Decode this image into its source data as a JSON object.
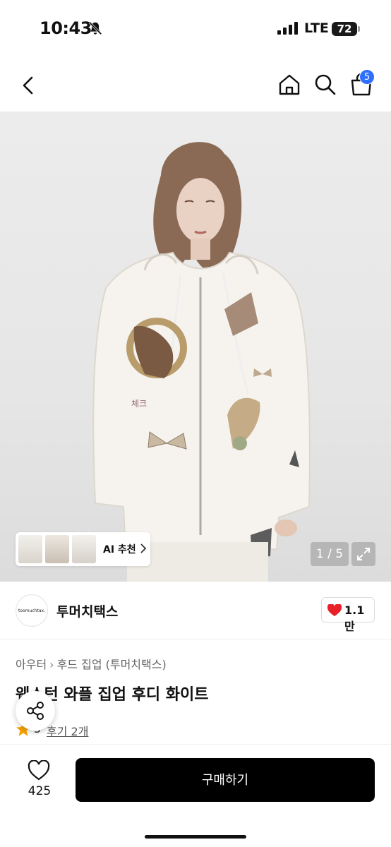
{
  "status_bar": {
    "time": "10:43",
    "network": "LTE",
    "battery": "72",
    "icons": [
      "bell-slash-icon",
      "signal-icon",
      "battery-icon"
    ]
  },
  "nav": {
    "icons": [
      "chevron-left-icon",
      "home-icon",
      "search-icon",
      "shopping-bag-icon"
    ],
    "cart_badge": "5"
  },
  "gallery": {
    "ai_label": "AI 추천",
    "counter": "1 / 5",
    "print_text": "체크"
  },
  "brand": {
    "logo_text": "toomuchtax.",
    "name": "투머치택스",
    "likes": "1.1만"
  },
  "product": {
    "breadcrumb": [
      "아우터",
      "후드 집업 (투머치택스)"
    ],
    "title": "웨스턴 와플 집업 후디 화이트",
    "rating": "5",
    "reviews_label": "후기 2개"
  },
  "bottom": {
    "wish_count": "425",
    "buy_label": "구매하기"
  },
  "colors": {
    "accent_blue": "#2f6fff",
    "heart_red": "#e8202a",
    "star_orange": "#f7a200",
    "buy_button": "#000000"
  }
}
